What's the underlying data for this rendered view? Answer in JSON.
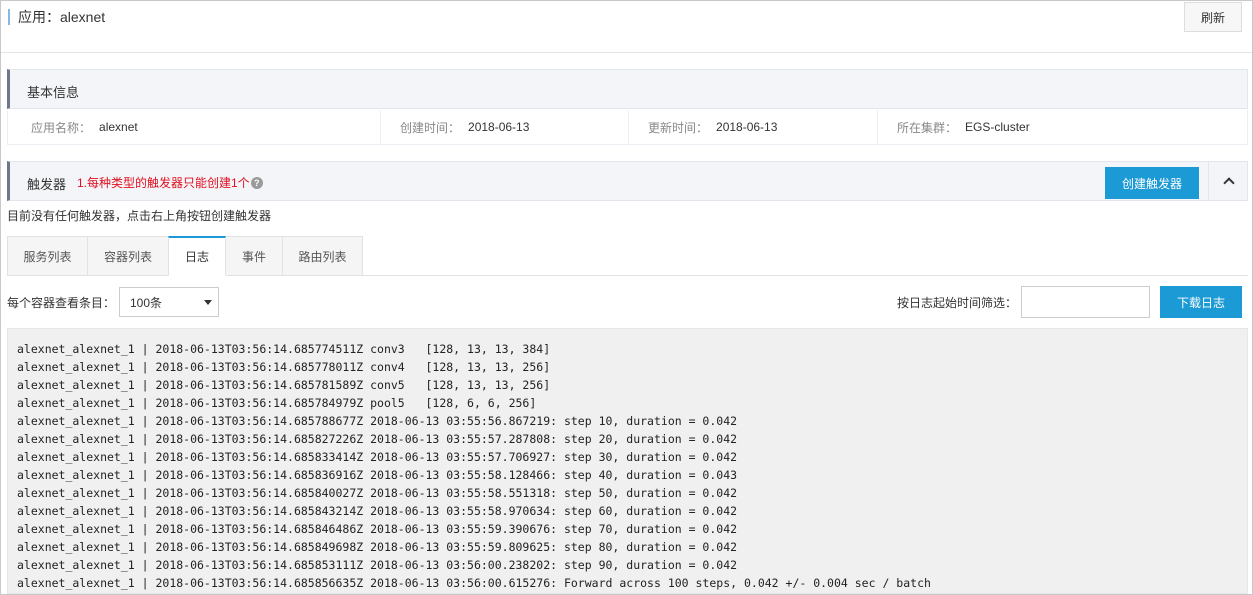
{
  "header": {
    "title": "应用：alexnet",
    "refresh_label": "刷新"
  },
  "basic": {
    "title": "基本信息",
    "fields": [
      {
        "key": "应用名称：",
        "value": "alexnet"
      },
      {
        "key": "创建时间：",
        "value": "2018-06-13"
      },
      {
        "key": "更新时间：",
        "value": "2018-06-13"
      },
      {
        "key": "所在集群：",
        "value": "EGS-cluster"
      }
    ]
  },
  "trigger": {
    "title": "触发器",
    "warning": "1.每种类型的触发器只能创建1个",
    "help_icon": "?",
    "create_label": "创建触发器",
    "empty_text": "目前没有任何触发器，点击右上角按钮创建触发器"
  },
  "tabs": [
    {
      "label": "服务列表"
    },
    {
      "label": "容器列表"
    },
    {
      "label": "日志",
      "active": true
    },
    {
      "label": "事件"
    },
    {
      "label": "路由列表"
    }
  ],
  "log_controls": {
    "per_container_label": "每个容器查看条目：",
    "per_container_value": "100条",
    "filter_label": "按日志起始时间筛选：",
    "filter_value": "",
    "download_label": "下载日志"
  },
  "log_lines": [
    "alexnet_alexnet_1 | 2018-06-13T03:56:14.685774511Z conv3   [128, 13, 13, 384]",
    "alexnet_alexnet_1 | 2018-06-13T03:56:14.685778011Z conv4   [128, 13, 13, 256]",
    "alexnet_alexnet_1 | 2018-06-13T03:56:14.685781589Z conv5   [128, 13, 13, 256]",
    "alexnet_alexnet_1 | 2018-06-13T03:56:14.685784979Z pool5   [128, 6, 6, 256]",
    "alexnet_alexnet_1 | 2018-06-13T03:56:14.685788677Z 2018-06-13 03:55:56.867219: step 10, duration = 0.042",
    "alexnet_alexnet_1 | 2018-06-13T03:56:14.685827226Z 2018-06-13 03:55:57.287808: step 20, duration = 0.042",
    "alexnet_alexnet_1 | 2018-06-13T03:56:14.685833414Z 2018-06-13 03:55:57.706927: step 30, duration = 0.042",
    "alexnet_alexnet_1 | 2018-06-13T03:56:14.685836916Z 2018-06-13 03:55:58.128466: step 40, duration = 0.043",
    "alexnet_alexnet_1 | 2018-06-13T03:56:14.685840027Z 2018-06-13 03:55:58.551318: step 50, duration = 0.042",
    "alexnet_alexnet_1 | 2018-06-13T03:56:14.685843214Z 2018-06-13 03:55:58.970634: step 60, duration = 0.042",
    "alexnet_alexnet_1 | 2018-06-13T03:56:14.685846486Z 2018-06-13 03:55:59.390676: step 70, duration = 0.042",
    "alexnet_alexnet_1 | 2018-06-13T03:56:14.685849698Z 2018-06-13 03:55:59.809625: step 80, duration = 0.042",
    "alexnet_alexnet_1 | 2018-06-13T03:56:14.685853111Z 2018-06-13 03:56:00.238202: step 90, duration = 0.042",
    "alexnet_alexnet_1 | 2018-06-13T03:56:14.685856635Z 2018-06-13 03:56:00.615276: Forward across 100 steps, 0.042 +/- 0.004 sec / batch"
  ]
}
